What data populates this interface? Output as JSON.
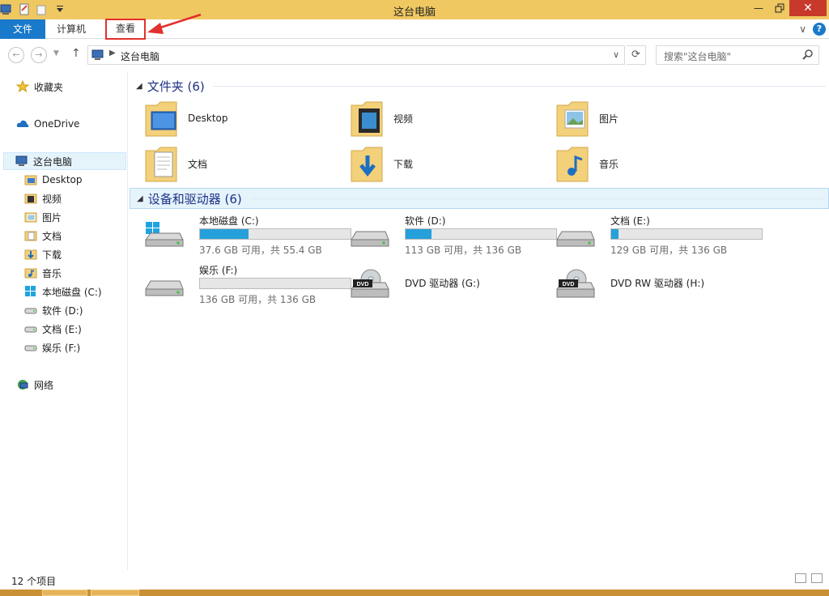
{
  "window": {
    "title": "这台电脑"
  },
  "ribbon": {
    "tabs": [
      "文件",
      "计算机",
      "查看"
    ]
  },
  "address": {
    "breadcrumb": "这台电脑",
    "search_placeholder": "搜索\"这台电脑\""
  },
  "nav": {
    "favorites": "收藏夹",
    "onedrive": "OneDrive",
    "this_pc": "这台电脑",
    "children": [
      "Desktop",
      "视频",
      "图片",
      "文档",
      "下载",
      "音乐",
      "本地磁盘 (C:)",
      "软件 (D:)",
      "文档 (E:)",
      "娱乐 (F:)"
    ],
    "network": "网络"
  },
  "folders": {
    "header": "文件夹 (6)",
    "items": [
      "Desktop",
      "视频",
      "图片",
      "文档",
      "下载",
      "音乐"
    ]
  },
  "devices": {
    "header": "设备和驱动器 (6)",
    "drives": [
      {
        "name": "本地磁盘 (C:)",
        "free": "37.6 GB 可用，共 55.4 GB",
        "used_fraction": 0.32
      },
      {
        "name": "软件 (D:)",
        "free": "113 GB 可用，共 136 GB",
        "used_fraction": 0.17
      },
      {
        "name": "文档 (E:)",
        "free": "129 GB 可用，共 136 GB",
        "used_fraction": 0.05
      },
      {
        "name": "娱乐 (F:)",
        "free": "136 GB 可用，共 136 GB",
        "used_fraction": 0.0
      }
    ],
    "dvd": [
      "DVD 驱动器 (G:)",
      "DVD RW 驱动器 (H:)"
    ]
  },
  "status": {
    "count": "12 个项目"
  },
  "colors": {
    "titlebar": "#f0c862",
    "file_tab": "#1979ca",
    "drive_bar": "#26a0da",
    "highlight_box": "#e2302d"
  }
}
